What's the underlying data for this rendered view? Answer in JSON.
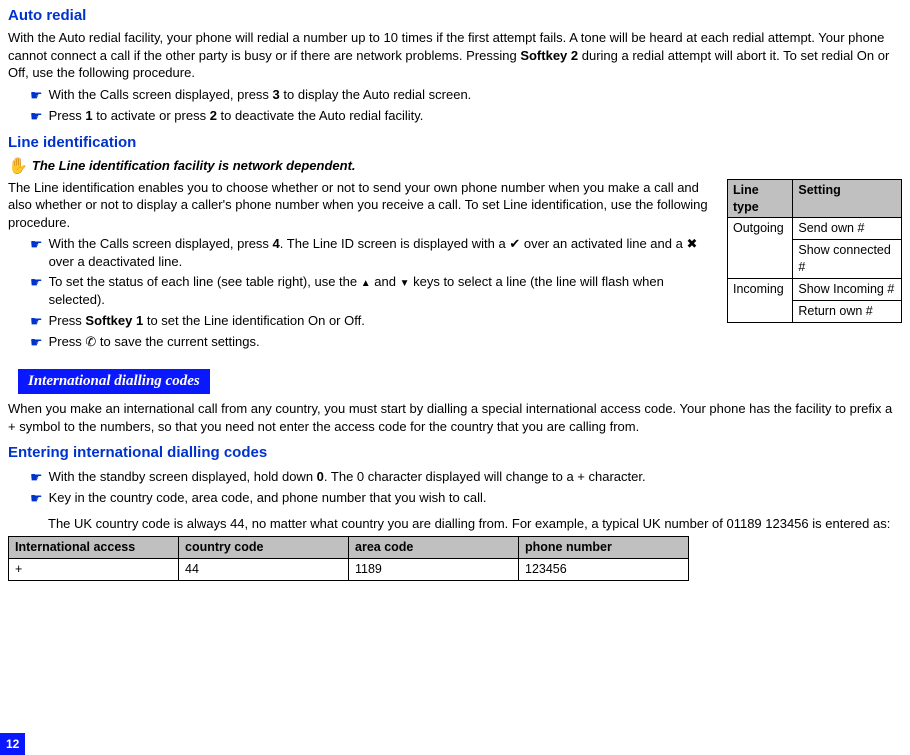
{
  "autoRedial": {
    "heading": "Auto redial",
    "para": "With the Auto redial facility, your phone will redial a number up to 10 times if the first attempt fails. A tone will be heard at each redial attempt. Your phone cannot connect a call if the other party is busy or if there are network problems. Pressing Softkey 2 during a redial attempt will abort it. To set redial On or Off, use the following procedure.",
    "b1": "With the Calls screen displayed, press 3 to display the Auto redial screen.",
    "b2": "Press 1 to activate or press 2 to deactivate the Auto redial facility."
  },
  "lineId": {
    "heading": "Line identification",
    "note": "The Line identification facility is network dependent.",
    "para": "The Line identification enables you to choose whether or not to send your own phone number when you make a call and also whether or not to display a caller's phone number when you receive a call. To set Line identification, use the following procedure.",
    "b1a": "With the Calls screen displayed, press ",
    "b1b": "4",
    "b1c": ". The Line ID screen is displayed with a ",
    "b1d": " over an activated line and a ",
    "b1e": " over a deactivated line.",
    "b2a": "To set the status of each line (see table right), use the ",
    "b2b": " and ",
    "b2c": " keys to select a line (the line will flash when selected).",
    "b3a": "Press ",
    "b3b": "Softkey 1",
    "b3c": " to set the Line identification On or Off.",
    "b4a": "Press ",
    "b4b": " to save the current settings.",
    "table": {
      "h1": "Line type",
      "h2": "Setting",
      "r1c1": "Outgoing",
      "r1c2": "Send own #",
      "r2c2": "Show connected #",
      "r3c1": "Incoming",
      "r3c2": "Show Incoming #",
      "r4c2": "Return own #"
    }
  },
  "intl": {
    "bar": "International dialling codes",
    "para": "When you make an international call from any country, you must start by dialling a special international access code. Your phone has the facility to prefix a + symbol to the numbers, so that you need not enter the access code for the country that you are calling from.",
    "subheading": "Entering international dialling codes",
    "b1a": "With the standby screen displayed, hold down ",
    "b1b": "0",
    "b1c": ". The 0 character displayed will change to a + character.",
    "b2": "Key in the country code, area code, and phone number that you wish to call.",
    "b2sub": "The UK country code is always 44, no matter what country you are dialling from. For example, a typical UK number of 01189 123456 is entered as:",
    "table": {
      "h1": "International access",
      "h2": "country code",
      "h3": "area code",
      "h4": "phone number",
      "r1c1": "+",
      "r1c2": "44",
      "r1c3": "1189",
      "r1c4": "123456"
    }
  },
  "pageNumber": "12"
}
